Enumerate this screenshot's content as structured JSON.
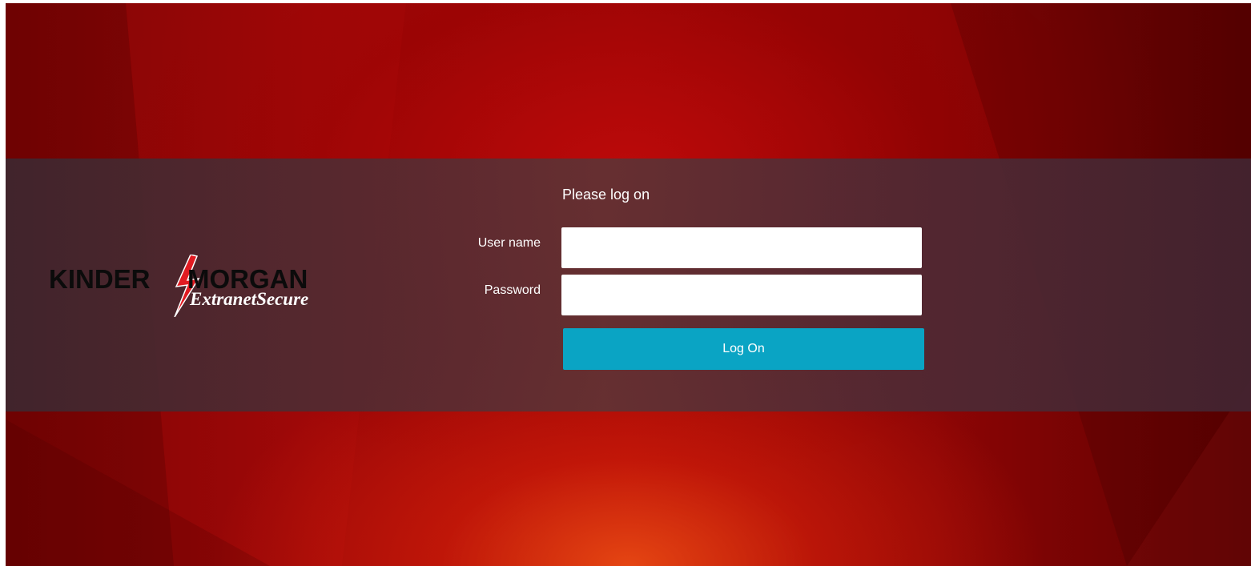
{
  "logo": {
    "brand_left": "KINDER",
    "brand_right": "MORGAN",
    "product": "ExtranetSecure",
    "bolt_color": "#e11b22"
  },
  "login": {
    "title": "Please log on",
    "username_label": "User name",
    "username_value": "",
    "password_label": "Password",
    "password_value": "",
    "submit_label": "Log On"
  },
  "colors": {
    "background": "#a50808",
    "band": "#5a3039",
    "button": "#0aa4c4"
  }
}
